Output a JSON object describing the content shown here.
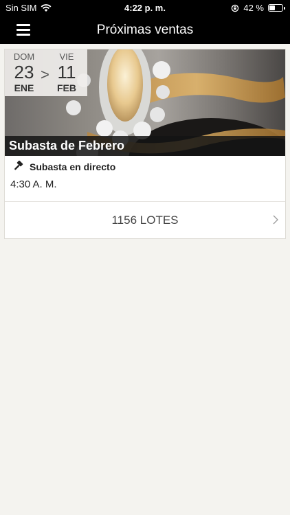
{
  "status_bar": {
    "carrier": "Sin SIM",
    "time": "4:22 p. m.",
    "battery": "42 %",
    "battery_level": 0.42
  },
  "nav": {
    "title": "Próximas ventas"
  },
  "sale": {
    "start": {
      "dow": "DOM",
      "day": "23",
      "month": "ENE"
    },
    "arrow": ">",
    "end": {
      "dow": "VIE",
      "day": "11",
      "month": "FEB"
    },
    "name": "Subasta de Febrero",
    "type": "Subasta en directo",
    "time": "4:30 A. M.",
    "lots": "1156 LOTES"
  }
}
